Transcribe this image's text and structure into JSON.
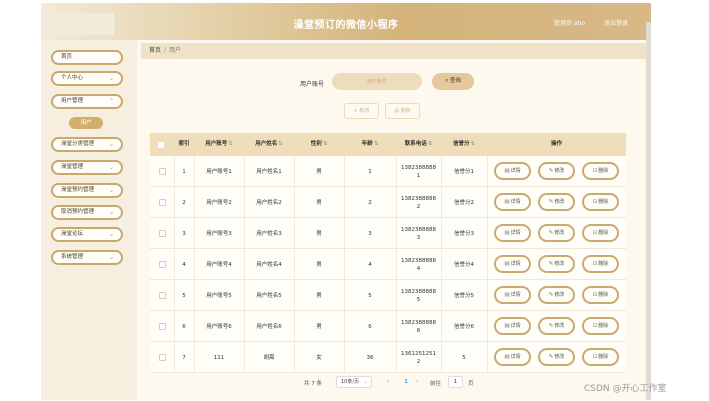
{
  "header": {
    "title": "澡堂预订的微信小程序",
    "admin_label": "管理员 abo",
    "logout_label": "退出登录"
  },
  "sidebar": {
    "items": [
      {
        "label": "首页",
        "has_chevron": false
      },
      {
        "label": "个人中心",
        "has_chevron": true
      },
      {
        "label": "用户管理",
        "has_chevron": true
      },
      {
        "label": "澡堂分类管理",
        "has_chevron": true
      },
      {
        "label": "澡堂管理",
        "has_chevron": true
      },
      {
        "label": "澡堂预约管理",
        "has_chevron": true
      },
      {
        "label": "取消预约管理",
        "has_chevron": true
      },
      {
        "label": "澡堂论坛",
        "has_chevron": true
      },
      {
        "label": "系统管理",
        "has_chevron": true
      }
    ],
    "active_sub": "用户"
  },
  "breadcrumb": {
    "home": "首页",
    "separator": "/",
    "current": "用户"
  },
  "search": {
    "label": "用户账号",
    "placeholder": "用户账号",
    "button_label": "查询",
    "button_icon": "search-icon"
  },
  "actions": {
    "add_label": "新增",
    "delete_label": "删除"
  },
  "table": {
    "columns": [
      {
        "label": "索引",
        "sortable": false
      },
      {
        "label": "用户账号",
        "sortable": true
      },
      {
        "label": "用户姓名",
        "sortable": true
      },
      {
        "label": "性别",
        "sortable": true
      },
      {
        "label": "年龄",
        "sortable": true
      },
      {
        "label": "联系电话",
        "sortable": true
      },
      {
        "label": "信誉分",
        "sortable": true
      },
      {
        "label": "操作",
        "sortable": false
      }
    ],
    "rows": [
      {
        "index": "1",
        "account": "用户账号1",
        "name": "用户姓名1",
        "gender": "男",
        "age": "1",
        "phone": "1382388888\n1",
        "credit": "信誉分1"
      },
      {
        "index": "2",
        "account": "用户账号2",
        "name": "用户姓名2",
        "gender": "男",
        "age": "2",
        "phone": "1382388888\n2",
        "credit": "信誉分2"
      },
      {
        "index": "3",
        "account": "用户账号3",
        "name": "用户姓名3",
        "gender": "男",
        "age": "3",
        "phone": "1382388888\n3",
        "credit": "信誉分3"
      },
      {
        "index": "4",
        "account": "用户账号4",
        "name": "用户姓名4",
        "gender": "男",
        "age": "4",
        "phone": "1382388888\n4",
        "credit": "信誉分4"
      },
      {
        "index": "5",
        "account": "用户账号5",
        "name": "用户姓名5",
        "gender": "男",
        "age": "5",
        "phone": "1382388888\n5",
        "credit": "信誉分5"
      },
      {
        "index": "6",
        "account": "用户账号6",
        "name": "用户姓名6",
        "gender": "男",
        "age": "6",
        "phone": "1382388888\n6",
        "credit": "信誉分6"
      },
      {
        "index": "7",
        "account": "111",
        "name": "胡嵩",
        "gender": "女",
        "age": "36",
        "phone": "1361251251\n2",
        "credit": "5"
      }
    ],
    "row_actions": {
      "detail": "详情",
      "edit": "修改",
      "delete": "删除"
    }
  },
  "pagination": {
    "total_text": "共 7 条",
    "page_size": "10条/页",
    "current_page": "1",
    "goto_label": "前往",
    "goto_value": "1",
    "page_suffix": "页"
  },
  "watermark": "CSDN @开心工作室"
}
